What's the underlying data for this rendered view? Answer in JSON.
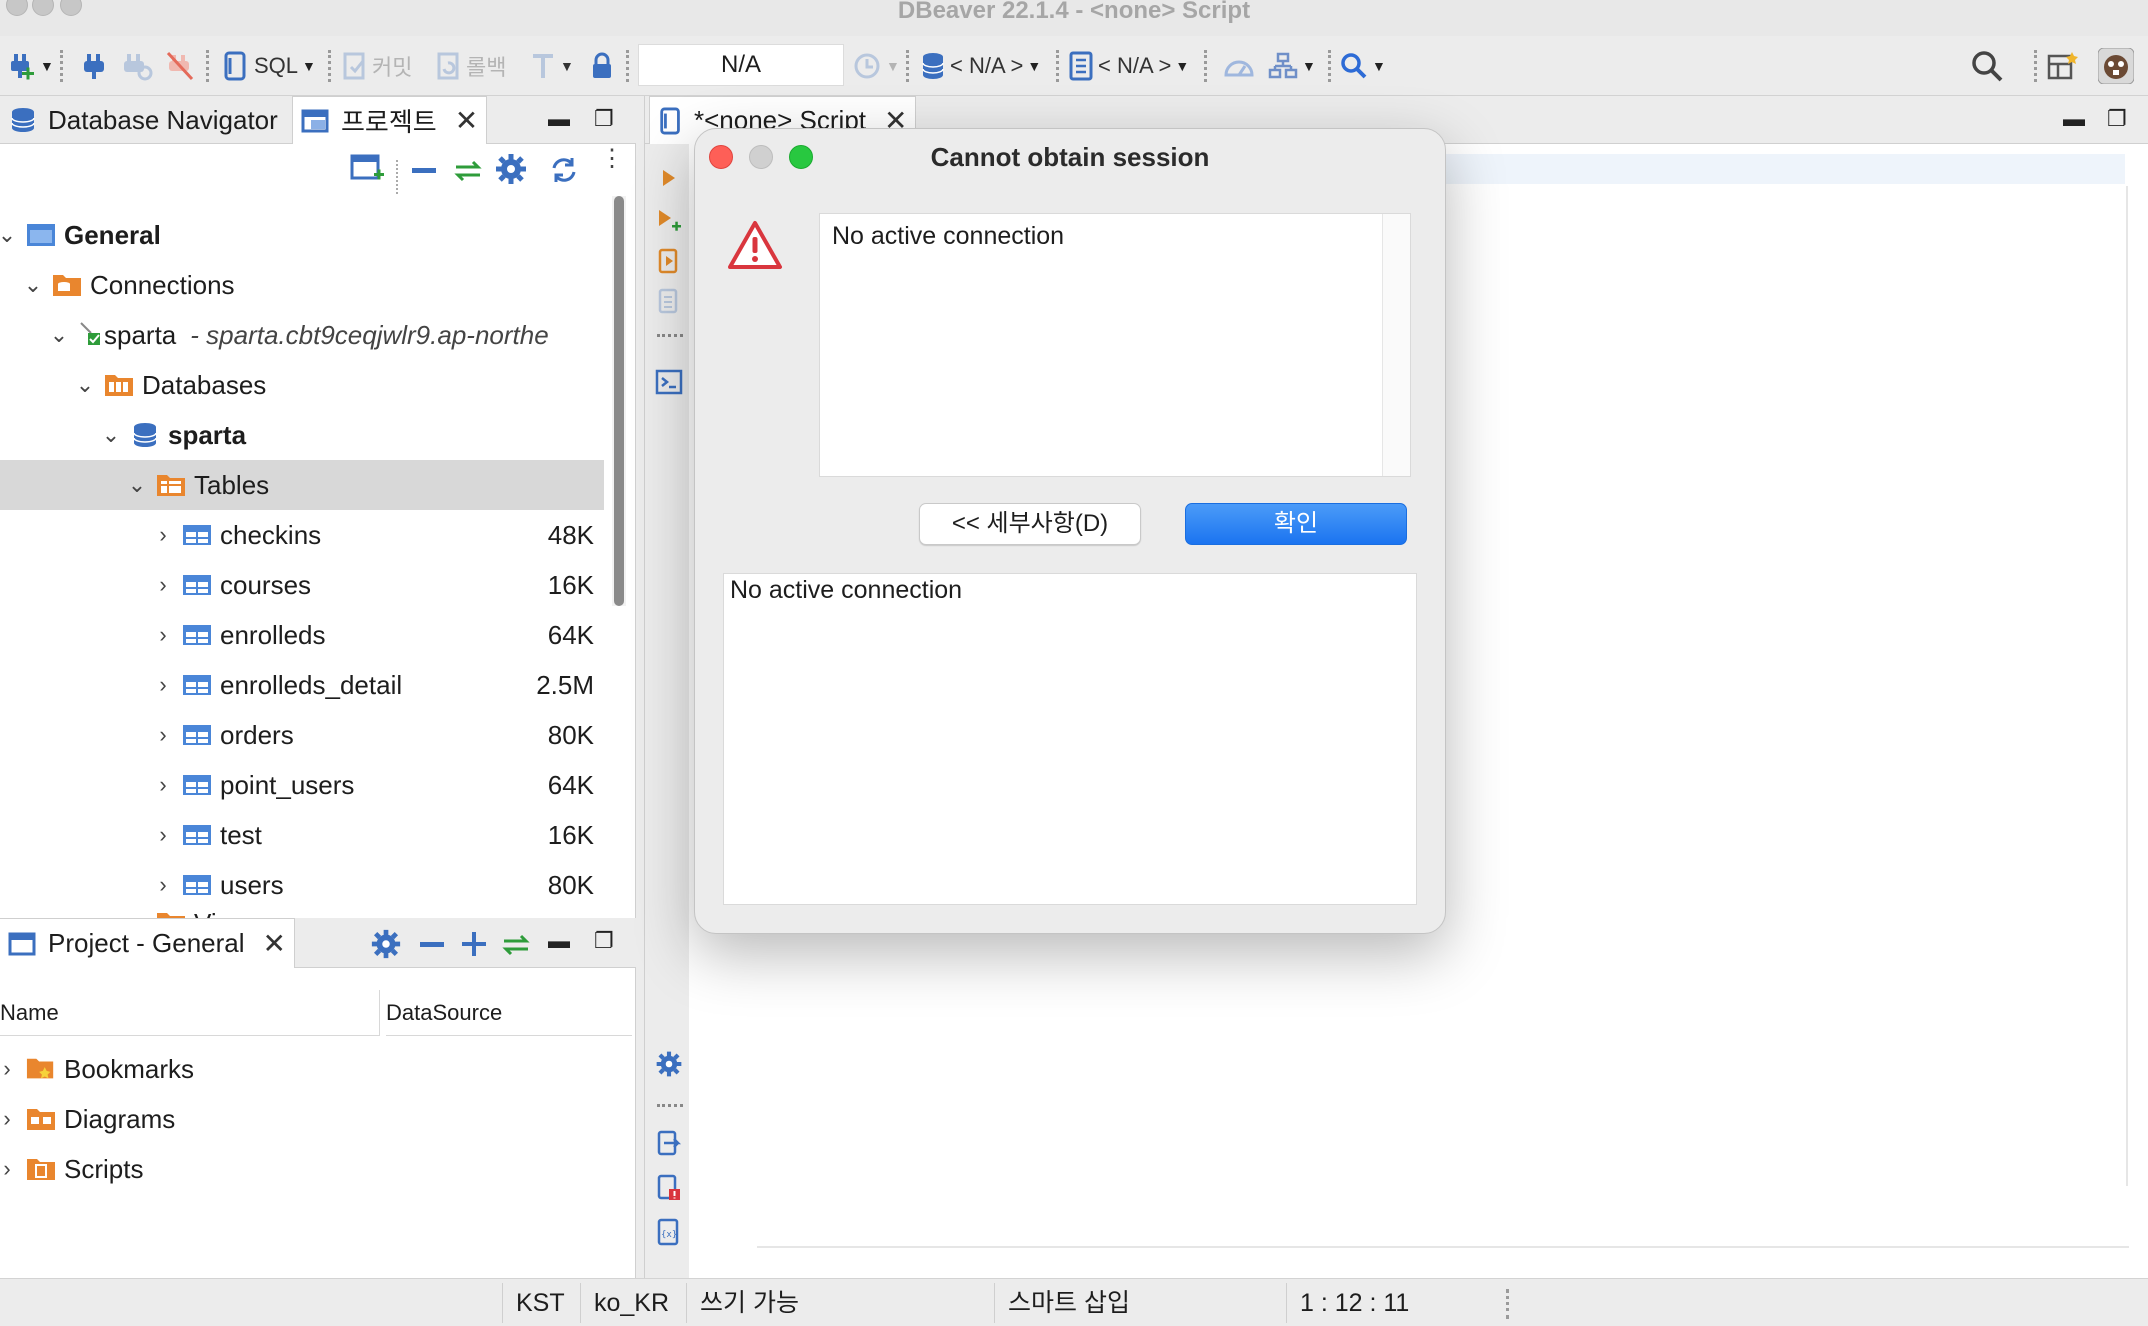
{
  "window": {
    "title": "DBeaver 22.1.4 - <none> Script"
  },
  "toolbar": {
    "sql_label": "SQL",
    "commit_label": "커밋",
    "rollback_label": "롤백",
    "transaction_mode_value": "N/A",
    "datasource_selector": "< N/A >",
    "schema_selector": "< N/A >"
  },
  "navigator": {
    "tabs": [
      {
        "label": "Database Navigator",
        "icon": "database-stack-icon"
      },
      {
        "label": "프로젝트",
        "icon": "project-icon"
      }
    ],
    "tree": [
      {
        "label": "General",
        "icon": "folder-blue-icon",
        "bold": true
      },
      {
        "label": "Connections",
        "icon": "folder-orange-icon"
      },
      {
        "label": "sparta",
        "detail": "- sparta.cbt9ceqjwlr9.ap-northe",
        "icon": "connection-ok-icon"
      },
      {
        "label": "Databases",
        "icon": "databases-icon"
      },
      {
        "label": "sparta",
        "icon": "database-icon",
        "bold": true
      },
      {
        "label": "Tables",
        "icon": "tables-folder-icon"
      },
      {
        "label": "checkins",
        "size": "48K",
        "icon": "table-icon"
      },
      {
        "label": "courses",
        "size": "16K",
        "icon": "table-icon"
      },
      {
        "label": "enrolleds",
        "size": "64K",
        "icon": "table-icon"
      },
      {
        "label": "enrolleds_detail",
        "size": "2.5M",
        "icon": "table-icon"
      },
      {
        "label": "orders",
        "size": "80K",
        "icon": "table-icon"
      },
      {
        "label": "point_users",
        "size": "64K",
        "icon": "table-icon"
      },
      {
        "label": "test",
        "size": "16K",
        "icon": "table-icon"
      },
      {
        "label": "users",
        "size": "80K",
        "icon": "table-icon"
      },
      {
        "label": "Views",
        "icon": "views-icon"
      }
    ]
  },
  "project": {
    "tab_label": "Project - General",
    "columns": [
      "Name",
      "DataSource"
    ],
    "items": [
      {
        "label": "Bookmarks",
        "icon": "bookmarks-folder-icon"
      },
      {
        "label": "Diagrams",
        "icon": "diagrams-folder-icon"
      },
      {
        "label": "Scripts",
        "icon": "scripts-folder-icon"
      }
    ]
  },
  "editor": {
    "tab_label": "*<none> Script"
  },
  "dialog": {
    "title": "Cannot obtain session",
    "message": "No active connection",
    "details_button": "<< 세부사항(D)",
    "ok_button": "확인",
    "details_text": "No active connection",
    "icon": "warning-triangle-icon"
  },
  "statusbar": {
    "timezone": "KST",
    "locale": "ko_KR",
    "write_mode": "쓰기 가능",
    "insert_mode": "스마트 삽입",
    "cursor_position": "1 : 12 : 11"
  },
  "colors": {
    "accent_blue": "#3b83e6",
    "table_blue": "#4a86d8",
    "folder_orange": "#e9862e",
    "warning_red": "#d9363e",
    "ok_button": "#1b74f0"
  }
}
